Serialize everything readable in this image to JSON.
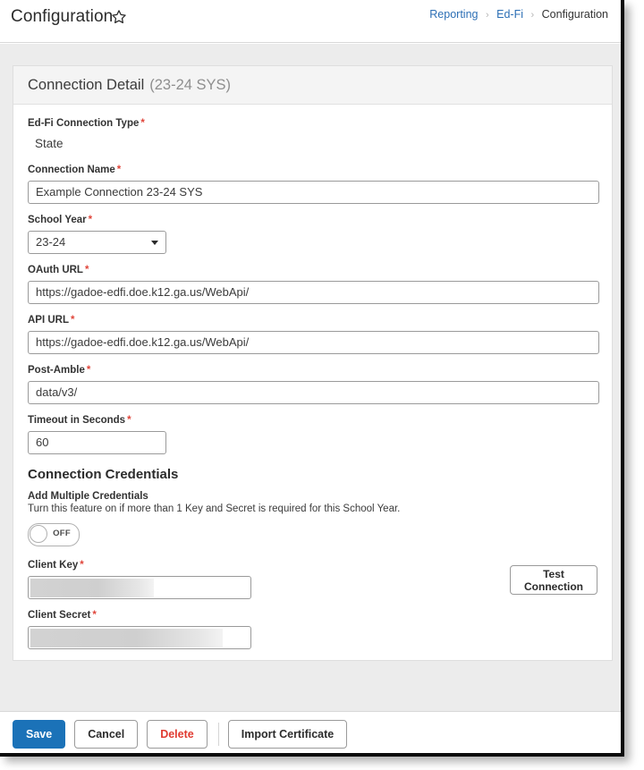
{
  "header": {
    "title": "Configuration",
    "favorite_icon": "star-icon",
    "breadcrumb": {
      "items": [
        "Reporting",
        "Ed-Fi",
        "Configuration"
      ],
      "separator": "›"
    }
  },
  "card": {
    "title": "Connection Detail",
    "subtitle": "(23-24 SYS)"
  },
  "form": {
    "required_marker": "*",
    "connection_type": {
      "label": "Ed-Fi Connection Type",
      "value": "State"
    },
    "connection_name": {
      "label": "Connection Name",
      "value": "Example Connection 23-24 SYS"
    },
    "school_year": {
      "label": "School Year",
      "value": "23-24",
      "caret_icon": "chevron-down-icon"
    },
    "oauth_url": {
      "label": "OAuth URL",
      "value": "https://gadoe-edfi.doe.k12.ga.us/WebApi/"
    },
    "api_url": {
      "label": "API URL",
      "value": "https://gadoe-edfi.doe.k12.ga.us/WebApi/"
    },
    "post_amble": {
      "label": "Post-Amble",
      "value": "data/v3/"
    },
    "timeout": {
      "label": "Timeout in Seconds",
      "value": "60"
    }
  },
  "credentials": {
    "section_title": "Connection Credentials",
    "multiple": {
      "label": "Add Multiple Credentials",
      "help": "Turn this feature on if more than 1 Key and Secret is required for this School Year.",
      "state": "OFF"
    },
    "client_key": {
      "label": "Client Key",
      "value": ""
    },
    "client_secret": {
      "label": "Client Secret",
      "value": ""
    },
    "test_button": "Test Connection"
  },
  "footer": {
    "save": "Save",
    "cancel": "Cancel",
    "delete": "Delete",
    "import_certificate": "Import Certificate"
  },
  "colors": {
    "primary": "#1b72b8",
    "link": "#2c6fb5",
    "danger": "#e03a30",
    "required": "#e0453a",
    "workarea": "#ececec"
  }
}
